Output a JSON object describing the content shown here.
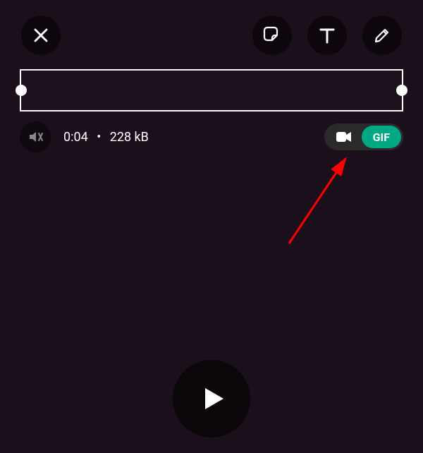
{
  "icons": {
    "close": "close-icon",
    "sticker": "sticker-icon",
    "text": "text-icon",
    "draw": "pencil-icon",
    "mute": "mute-icon",
    "video": "video-icon",
    "play": "play-icon"
  },
  "meta": {
    "duration": "0:04",
    "separator": "•",
    "size": "228 kB"
  },
  "toggle": {
    "gif_label": "GIF",
    "active": "gif"
  },
  "colors": {
    "accent": "#00a884",
    "arrow": "#ff0000"
  }
}
